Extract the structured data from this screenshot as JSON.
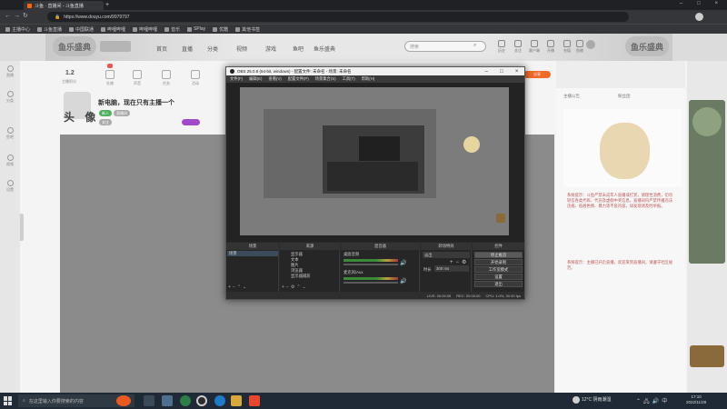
{
  "browser": {
    "tab_title": "斗鱼 · 直播间 - 斗鱼直播",
    "url": "https://www.douyu.com/9979797",
    "bookmarks": [
      "主播中心",
      "斗鱼直播",
      "中国联通",
      "哔哩哔哩",
      "哔哩哔哩",
      "音乐",
      "SPlay",
      "优酷",
      "其他书签"
    ]
  },
  "site": {
    "nav": [
      "首页",
      "直播",
      "分类",
      "视频",
      "游戏",
      "鱼吧",
      "鱼乐盛典"
    ],
    "festival_left": "鱼乐盛典",
    "festival_right": "鱼乐盛典",
    "search_placeholder": "搜索",
    "top_icons": [
      "历史",
      "关注",
      "客户端",
      "开播",
      "充值",
      "鱼粮"
    ],
    "sidebar": [
      "直播",
      "分类",
      "鱼吧",
      "视频",
      "设置"
    ],
    "room": {
      "count": "1.2",
      "count_label": "主播积分",
      "header_icons": [
        "礼物",
        "声音",
        "任务",
        "活动",
        "分享"
      ],
      "title": "新电脑，现在只有主播一个",
      "streamer": "头 像",
      "tags": [
        "新人",
        "直播间",
        "关注"
      ]
    },
    "right_panel": {
      "tabs": [
        "主播公告",
        "粉丝团"
      ],
      "notice": "系统提示：斗鱼严禁未成年人直播或打赏，请理性消费，切勿轻信各类代练、代充及虚假中奖信息。直播间内严禁传播违法违规、低俗色情、暴力等不良内容，如发现请及时举报。",
      "notice2": "系统提示：主播已开启直播，欢迎来到直播间，请遵守社区规范。"
    }
  },
  "obs": {
    "title": "OBS 25.0.8 (64-bit, windows) - 配置文件: 未命名 - 场景: 未命名",
    "menu": [
      "文件(F)",
      "编辑(E)",
      "查看(V)",
      "配置文件(P)",
      "场景集合(S)",
      "工具(T)",
      "帮助(H)"
    ],
    "docks": [
      "场景",
      "来源",
      "混音器",
      "转场特效",
      "控件"
    ],
    "scenes": [
      "场景"
    ],
    "sources": [
      "显示器",
      "文本",
      "图片",
      "浏览器",
      "显示器捕获"
    ],
    "mixer": [
      "桌面音频",
      "麦克风/Aux"
    ],
    "transition": {
      "type": "淡出",
      "duration_label": "时长",
      "duration": "300 ms"
    },
    "controls": [
      "停止推流",
      "开始录制",
      "工作室模式",
      "设置",
      "退出"
    ],
    "status": [
      "LIVE: 00:00:05",
      "REC: 00:00:00",
      "CPU: 1.0%, 30.00 fps"
    ]
  },
  "taskbar": {
    "search_placeholder": "在这里输入你要搜索的内容",
    "weather": "12°C 阴雨潮湿",
    "time": "17:10",
    "date": "2022/11/28"
  }
}
